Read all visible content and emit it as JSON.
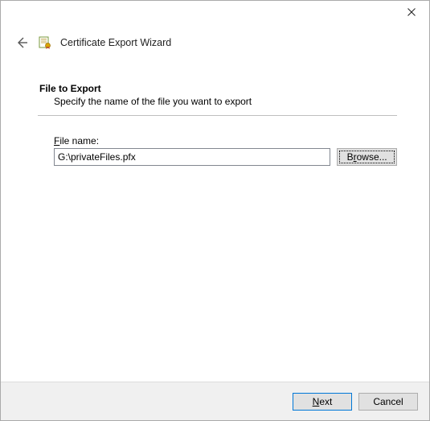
{
  "titlebar": {
    "close_aria": "Close"
  },
  "header": {
    "back_aria": "Back",
    "wizard_title": "Certificate Export Wizard"
  },
  "step": {
    "title": "File to Export",
    "description": "Specify the name of the file you want to export"
  },
  "file": {
    "label_prefix": "",
    "label_letter": "F",
    "label_suffix": "ile name:",
    "value": "G:\\privateFiles.pfx",
    "browse_prefix": "B",
    "browse_letter": "r",
    "browse_suffix": "owse..."
  },
  "footer": {
    "next_letter": "N",
    "next_suffix": "ext",
    "cancel": "Cancel"
  }
}
